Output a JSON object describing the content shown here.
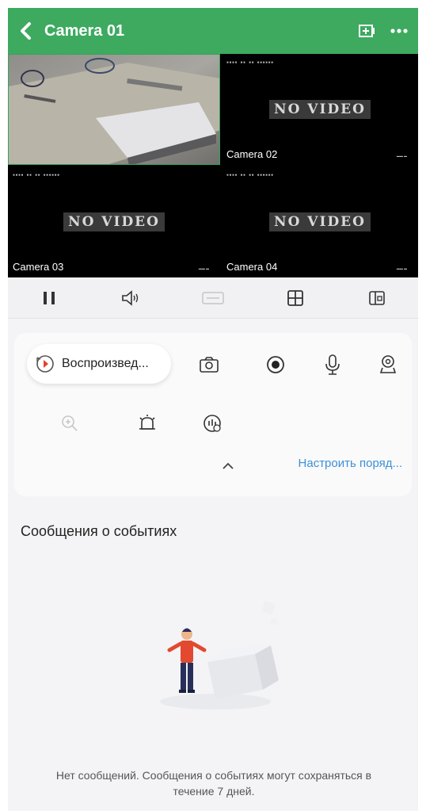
{
  "header": {
    "title": "Camera 01",
    "back_icon": "chevron-left-icon",
    "screen_icon": "add-screen-icon",
    "more_icon": "more-dots-icon",
    "color": "#3daa5f"
  },
  "grid": {
    "tiles": [
      {
        "label": "",
        "status": ""
      },
      {
        "label": "Camera 02",
        "status": "NO VIDEO"
      },
      {
        "label": "Camera 03",
        "status": "NO VIDEO"
      },
      {
        "label": "Camera 04",
        "status": "NO VIDEO"
      }
    ]
  },
  "toolbar": {
    "items": [
      "pause-icon",
      "volume-icon",
      "quality-icon",
      "grid-layout-icon",
      "window-icon"
    ]
  },
  "controls": {
    "playback_label": "Воспроизвед...",
    "icons_row1": [
      "playback-icon",
      "camera-snapshot-icon",
      "record-icon",
      "microphone-icon",
      "ptz-icon"
    ],
    "icons_row2": [
      "zoom-icon",
      "alarm-icon",
      "speed-icon"
    ],
    "customize_label": "Настроить поряд...",
    "accent": "#3d8fd8"
  },
  "events": {
    "title": "Сообщения о событиях",
    "empty_text": "Нет сообщений. Сообщения о событиях могут сохраняться в течение 7 дней."
  }
}
